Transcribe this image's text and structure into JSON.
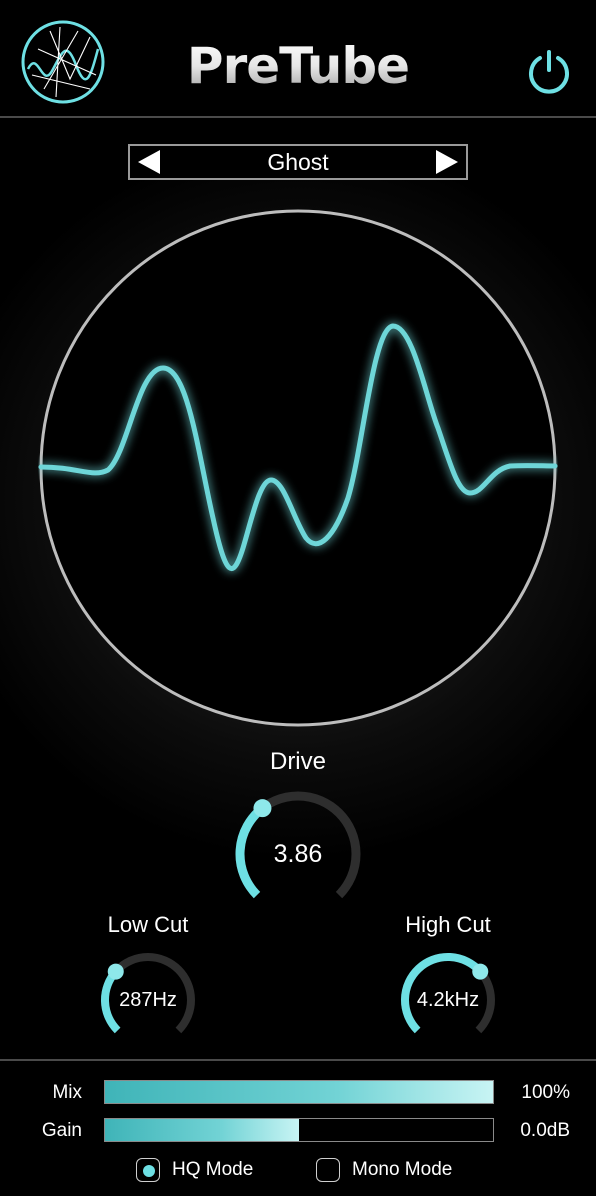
{
  "app": {
    "title": "PreTube",
    "logo_icon": "waveform-globe-logo",
    "power_icon": "power-icon",
    "accent": "#6ee0e4"
  },
  "preset": {
    "name": "Ghost",
    "prev_icon": "triangle-left-icon",
    "next_icon": "triangle-right-icon"
  },
  "knobs": {
    "drive": {
      "label": "Drive",
      "value": "3.86",
      "fraction": 0.36
    },
    "low_cut": {
      "label": "Low Cut",
      "value": "287Hz",
      "fraction": 0.32
    },
    "high_cut": {
      "label": "High Cut",
      "value": "4.2kHz",
      "fraction": 0.68
    }
  },
  "sliders": {
    "mix": {
      "label": "Mix",
      "value": "100%",
      "fraction": 1.0
    },
    "gain": {
      "label": "Gain",
      "value": "0.0dB",
      "fraction": 0.5
    }
  },
  "options": {
    "hq_mode": {
      "label": "HQ Mode",
      "checked": true
    },
    "mono_mode": {
      "label": "Mono Mode",
      "checked": false
    }
  }
}
